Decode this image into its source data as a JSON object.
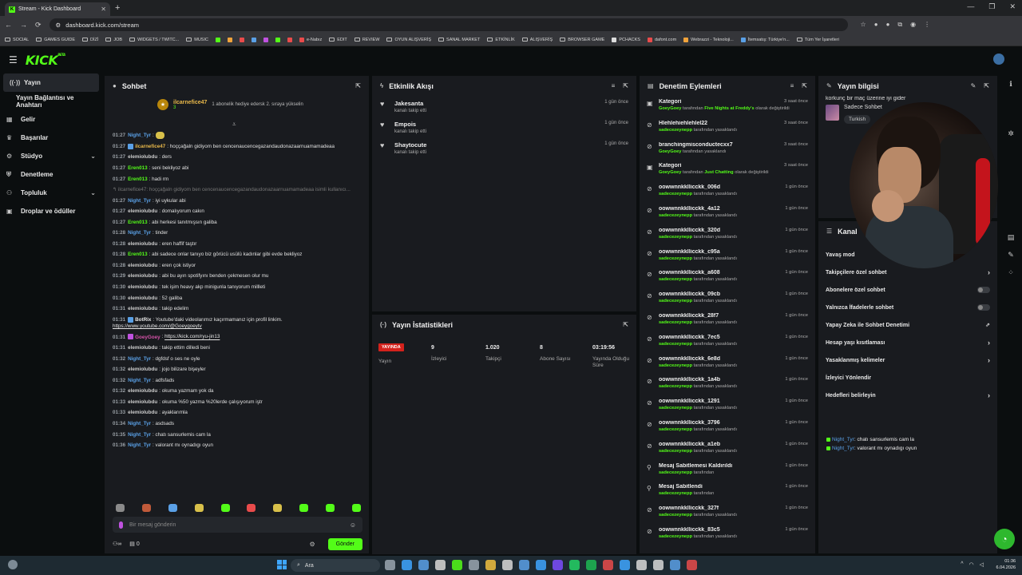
{
  "browser": {
    "tab_title": "Stream - Kick Dashboard",
    "url": "dashboard.kick.com/stream",
    "bookmarks": [
      "SOCIAL",
      "GAMES GUIDE",
      "DİZİ",
      "JOB",
      "WIDGETS / TWITC...",
      "MUSIC",
      "e-Nabız",
      "EDIT",
      "REVIEW",
      "OYUN ALIŞVERİŞ",
      "SANAL MARKET",
      "ETKİNLİK",
      "ALIŞVERİŞ",
      "BROWSER GAME",
      "PCHACKS",
      "dafont.com",
      "Webrazzi - Teknoloji...",
      "İtemsatış: Türkiye'n...",
      "Tüm Yer İşaretleri"
    ]
  },
  "app": {
    "logo": "KICK",
    "logo_sup": "BETA"
  },
  "sidebar": {
    "items": [
      {
        "label": "Yayın",
        "icon": "broadcast-icon"
      },
      {
        "label": "Yayın Bağlantısı ve Anahtarı"
      },
      {
        "label": "Gelir",
        "icon": "revenue-icon"
      },
      {
        "label": "Başarılar",
        "icon": "trophy-icon"
      },
      {
        "label": "Stüdyo",
        "icon": "studio-icon"
      },
      {
        "label": "Denetleme",
        "icon": "shield-icon"
      },
      {
        "label": "Topluluk",
        "icon": "community-icon"
      },
      {
        "label": "Droplar ve ödüller",
        "icon": "gift-icon"
      }
    ]
  },
  "chat": {
    "title": "Sohbet",
    "pinned_user": "ilcarnefice47",
    "pinned_count": "3",
    "pinned_text": "1 abonelik hediye edersk 2. sıraya yükselin",
    "messages": [
      {
        "t": "01:27",
        "u": "Night_Tyr",
        "c": "#5aa0e6",
        "m": ""
      },
      {
        "t": "01:27",
        "u": "ilcarnefice47",
        "c": "#e8b84a",
        "m": "hoççağaln gidiyom ben cencenaucencegazandaudonazaarnuamamadeaa"
      },
      {
        "t": "01:27",
        "u": "elemiolubdu",
        "c": "#cccccc",
        "m": "ders"
      },
      {
        "t": "01:27",
        "u": "Eren013",
        "c": "#53fc18",
        "m": "seni bekliyoz abi"
      },
      {
        "t": "01:27",
        "u": "Eren013",
        "c": "#53fc18",
        "m": "hadi rm"
      },
      {
        "t": "",
        "u": "",
        "c": "#777777",
        "m": "↰ ilcarnefice47: hoççağaln gidiyom ben cencenaucencegazandaudonazaarnuamamadeaa isimli kullanıcı..."
      },
      {
        "t": "01:27",
        "u": "Night_Tyr",
        "c": "#5aa0e6",
        "m": "iyi uykular abi"
      },
      {
        "t": "01:27",
        "u": "elemiolubdu",
        "c": "#cccccc",
        "m": "domalıyorum cakın"
      },
      {
        "t": "01:27",
        "u": "Eren013",
        "c": "#53fc18",
        "m": "abi herkesi tanıtmışsın galiba"
      },
      {
        "t": "01:28",
        "u": "Night_Tyr",
        "c": "#5aa0e6",
        "m": "tinder"
      },
      {
        "t": "01:28",
        "u": "elemiolubdu",
        "c": "#cccccc",
        "m": "eren haffif taştır"
      },
      {
        "t": "01:28",
        "u": "Eren013",
        "c": "#53fc18",
        "m": "abi sadece onlar tanıyo biz görücü usülü kadınlar gibi evde bekliyoz"
      },
      {
        "t": "01:28",
        "u": "elemiolubdu",
        "c": "#cccccc",
        "m": "eren çok istiyor"
      },
      {
        "t": "01:29",
        "u": "elemiolubdu",
        "c": "#cccccc",
        "m": "abi bu ayın spotifyını benden çekmesen olur mu"
      },
      {
        "t": "01:30",
        "u": "elemiolubdu",
        "c": "#cccccc",
        "m": "tek işim heavy akp minigunla tanıyorum millleti"
      },
      {
        "t": "01:30",
        "u": "elemiolubdu",
        "c": "#cccccc",
        "m": "52 galiba"
      },
      {
        "t": "01:31",
        "u": "elemiolubdu",
        "c": "#cccccc",
        "m": "takip edelim"
      },
      {
        "t": "01:31",
        "u": "BotRix",
        "c": "#e8e8e8",
        "m": "Youtube'daki videolarımız kaçırmamanız için profil linkim.",
        "link": "https://www.youtube.com/@Goeygoeytv"
      },
      {
        "t": "01:31",
        "u": "GoeyGoey",
        "c": "#d452a8",
        "m": "",
        "link": "https://kick.com/ryu-jin13"
      },
      {
        "t": "01:31",
        "u": "elemiolubdu",
        "c": "#cccccc",
        "m": "takip ettim dilledi beni"
      },
      {
        "t": "01:32",
        "u": "Night_Tyr",
        "c": "#5aa0e6",
        "m": "dgfdsf o ses ne oyle"
      },
      {
        "t": "01:32",
        "u": "elemiolubdu",
        "c": "#cccccc",
        "m": "jojo bilizare bişeyler"
      },
      {
        "t": "01:32",
        "u": "Night_Tyr",
        "c": "#5aa0e6",
        "m": "adfsfads"
      },
      {
        "t": "01:32",
        "u": "elemiolubdu",
        "c": "#cccccc",
        "m": "okuma yazmam yok da"
      },
      {
        "t": "01:33",
        "u": "elemiolubdu",
        "c": "#cccccc",
        "m": "okuma %50 yazma %20lerde çalışıyorum iştr"
      },
      {
        "t": "01:33",
        "u": "elemiolubdu",
        "c": "#cccccc",
        "m": "ayaklarımla"
      },
      {
        "t": "01:34",
        "u": "Night_Tyr",
        "c": "#5aa0e6",
        "m": "asdsads"
      },
      {
        "t": "01:35",
        "u": "Night_Tyr",
        "c": "#5aa0e6",
        "m": "chatı sansurlemis cam la"
      },
      {
        "t": "01:36",
        "u": "Night_Tyr",
        "c": "#5aa0e6",
        "m": "valorant mı oynadıgı oyun"
      }
    ],
    "input_placeholder": "Bir mesaj gönderin",
    "viewer_count": "0",
    "send_label": "Gönder"
  },
  "activity": {
    "title": "Etkinlik Akışı",
    "items": [
      {
        "name": "Jakesanta",
        "sub": "kanalı takip etti",
        "time": "1 gün önce"
      },
      {
        "name": "Empois",
        "sub": "kanalı takip etti",
        "time": "1 gün önce"
      },
      {
        "name": "Shaytocute",
        "sub": "kanalı takip etti",
        "time": "1 gün önce"
      }
    ]
  },
  "stats": {
    "title": "Yayın İstatistikleri",
    "live_label": "YAYINDA",
    "live_sub": "Yayın",
    "viewers": "9",
    "viewers_label": "İzleyici",
    "followers": "1.020",
    "followers_label": "Takipçi",
    "subs": "8",
    "subs_label": "Abone Sayısı",
    "uptime": "03:19:56",
    "uptime_label": "Yayında Olduğu Süre"
  },
  "moderation": {
    "title": "Denetim Eylemleri",
    "items": [
      {
        "type": "category",
        "name": "Kategori",
        "by": "GoeyGoey",
        "mid": "tarafından",
        "hl": "Five Nights at Freddy's",
        "end": "olarak değiştirildi",
        "time": "3 saat önce"
      },
      {
        "type": "ban",
        "name": "Hlehlehiehlehlel22",
        "by": "sadecezeynepp",
        "end": "tarafından yasaklandı",
        "time": "3 saat önce"
      },
      {
        "type": "ban",
        "name": "branchingmisconductecxx7",
        "by": "GoeyGoey",
        "end": "tarafından yasaklandı",
        "time": "3 saat önce"
      },
      {
        "type": "category",
        "name": "Kategori",
        "by": "GoeyGoey",
        "mid": "tarafından",
        "hl": "Just Chatting",
        "end": "olarak değiştirildi",
        "time": "3 saat önce"
      },
      {
        "type": "ban",
        "name": "oowwnnkkllicckk_006d",
        "by": "sadecezeynepp",
        "end": "tarafından yasaklandı",
        "time": "1 gün önce"
      },
      {
        "type": "ban",
        "name": "oowwnnkkllicckk_4a12",
        "by": "sadecezeynepp",
        "end": "tarafından yasaklandı",
        "time": "1 gün önce"
      },
      {
        "type": "ban",
        "name": "oowwnnkkllicckk_320d",
        "by": "sadecezeynepp",
        "end": "tarafından yasaklandı",
        "time": "1 gün önce"
      },
      {
        "type": "ban",
        "name": "oowwnnkkllicckk_c95a",
        "by": "sadecezeynepp",
        "end": "tarafından yasaklandı",
        "time": "1 gün önce"
      },
      {
        "type": "ban",
        "name": "oowwnnkkllicckk_a608",
        "by": "sadecezeynepp",
        "end": "tarafından yasaklandı",
        "time": "1 gün önce"
      },
      {
        "type": "ban",
        "name": "oowwnnkkllicckk_09cb",
        "by": "sadecezeynepp",
        "end": "tarafından yasaklandı",
        "time": "1 gün önce"
      },
      {
        "type": "ban",
        "name": "oowwnnkkllicckk_28f7",
        "by": "sadecezeynepp",
        "end": "tarafından yasaklandı",
        "time": "1 gün önce"
      },
      {
        "type": "ban",
        "name": "oowwnnkkllicckk_7ec5",
        "by": "sadecezeynepp",
        "end": "tarafından yasaklandı",
        "time": "1 gün önce"
      },
      {
        "type": "ban",
        "name": "oowwnnkkllicckk_6e8d",
        "by": "sadecezeynepp",
        "end": "tarafından yasaklandı",
        "time": "1 gün önce"
      },
      {
        "type": "ban",
        "name": "oowwnnkkllicckk_1a4b",
        "by": "sadecezeynepp",
        "end": "tarafından yasaklandı",
        "time": "1 gün önce"
      },
      {
        "type": "ban",
        "name": "oowwnnkkllicckk_1291",
        "by": "sadecezeynepp",
        "end": "tarafından yasaklandı",
        "time": "1 gün önce"
      },
      {
        "type": "ban",
        "name": "oowwnnkkllicckk_3796",
        "by": "sadecezeynepp",
        "end": "tarafından yasaklandı",
        "time": "1 gün önce"
      },
      {
        "type": "ban",
        "name": "oowwnnkkllicckk_a1eb",
        "by": "sadecezeynepp",
        "end": "tarafından yasaklandı",
        "time": "1 gün önce"
      },
      {
        "type": "unpin",
        "name": "Mesaj Sabitlemesi Kaldırıldı",
        "by": "sadecezeynepp",
        "end": "tarafından",
        "time": "1 gün önce"
      },
      {
        "type": "pin",
        "name": "Mesaj Sabitlendi",
        "by": "sadecezeynepp",
        "end": "tarafından",
        "time": "1 gün önce"
      },
      {
        "type": "ban",
        "name": "oowwnnkkllicckk_327f",
        "by": "sadecezeynepp",
        "end": "tarafından yasaklandı",
        "time": "1 gün önce"
      },
      {
        "type": "ban",
        "name": "oowwnnkkllicckk_83c5",
        "by": "sadecezeynepp",
        "end": "tarafından yasaklandı",
        "time": "1 gün önce"
      }
    ]
  },
  "info": {
    "title": "Yayın bilgisi",
    "stream_title": "korkunç bir maç üzerine iyi gider",
    "category": "Sadece Sohbet",
    "tag": "Turkish"
  },
  "channel": {
    "title": "Kanal",
    "rows": [
      {
        "label": "Yavaş mod",
        "ctrl": "none"
      },
      {
        "label": "Takipçilere özel sohbet",
        "ctrl": "chev"
      },
      {
        "label": "Abonelere özel sohbet",
        "ctrl": "toggle"
      },
      {
        "label": "Yalnızca İfadelerle sohbet",
        "ctrl": "toggle"
      },
      {
        "label": "Yapay Zeka ile Sohbet Denetimi",
        "ctrl": "ext"
      },
      {
        "label": "Hesap yaşı kısıtlaması",
        "ctrl": "chev"
      },
      {
        "label": "Yasaklanmış kelimeler",
        "ctrl": "chev"
      },
      {
        "label": "İzleyici Yönlendir",
        "ctrl": "none"
      },
      {
        "label": "Hedefleri belirleyin",
        "ctrl": "chev"
      }
    ],
    "mini_chat": [
      {
        "u": "Night_Tyr",
        "m": "chatı sansurlemis cam la"
      },
      {
        "u": "Night_Tyr",
        "m": "valorant mı oynadıgı oyun"
      }
    ]
  },
  "taskbar": {
    "search": "Ara",
    "time": "01:36",
    "date": "6.04.2026"
  }
}
